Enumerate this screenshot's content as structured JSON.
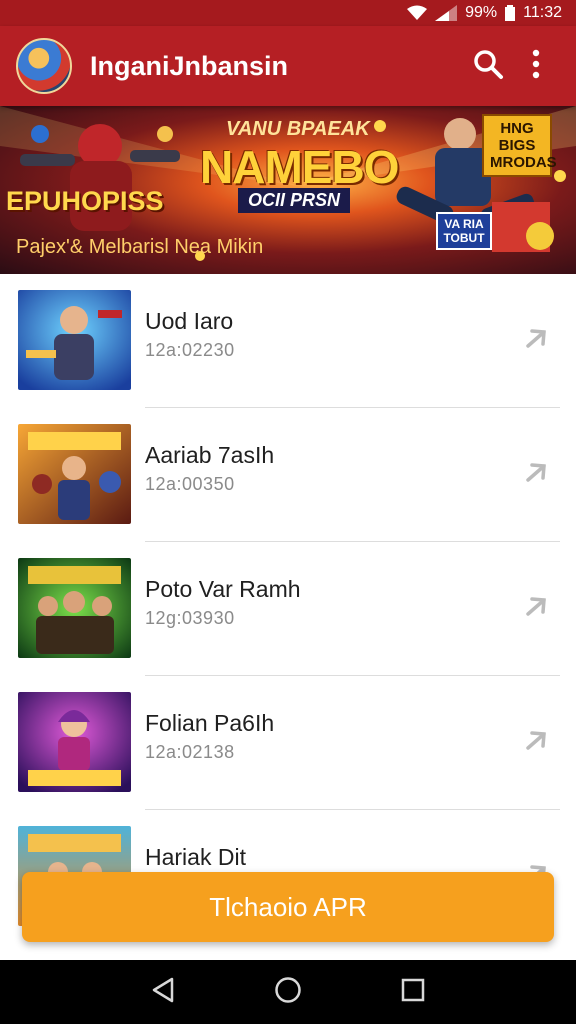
{
  "status_bar": {
    "battery": "99%",
    "time": "11:32",
    "icons": [
      "wifi-icon",
      "signal-icon",
      "battery-icon"
    ]
  },
  "app_bar": {
    "title": "InganiJnbansin",
    "actions": [
      "search-icon",
      "more-vert-icon"
    ]
  },
  "banner": {
    "tagline": "VANU BPAEAK",
    "headline": "NAMEBO",
    "subline": "OCII PRSN",
    "left_text": "EPUHOPISS",
    "bottom_text": "Pajex'& Melbarisl Nea Mikin",
    "badge": "HNG BIGS MRODAS",
    "box_label": "VA RIA TOBUT"
  },
  "games": [
    {
      "title": "Uod Iaro",
      "subtitle": "12a:02230"
    },
    {
      "title": "Aariab 7asIh",
      "subtitle": "12a:00350"
    },
    {
      "title": "Poto Var Ramh",
      "subtitle": "12g:03930"
    },
    {
      "title": "Folian Pa6Ih",
      "subtitle": "12a:02138"
    },
    {
      "title": "Hariak Dit",
      "subtitle": ""
    }
  ],
  "cta": {
    "label": "Tlchaoio APR"
  },
  "nav": [
    "back-icon",
    "home-icon",
    "recents-icon"
  ],
  "colors": {
    "primary": "#b51f24",
    "status": "#a51a1e",
    "accent": "#f6a01e"
  }
}
